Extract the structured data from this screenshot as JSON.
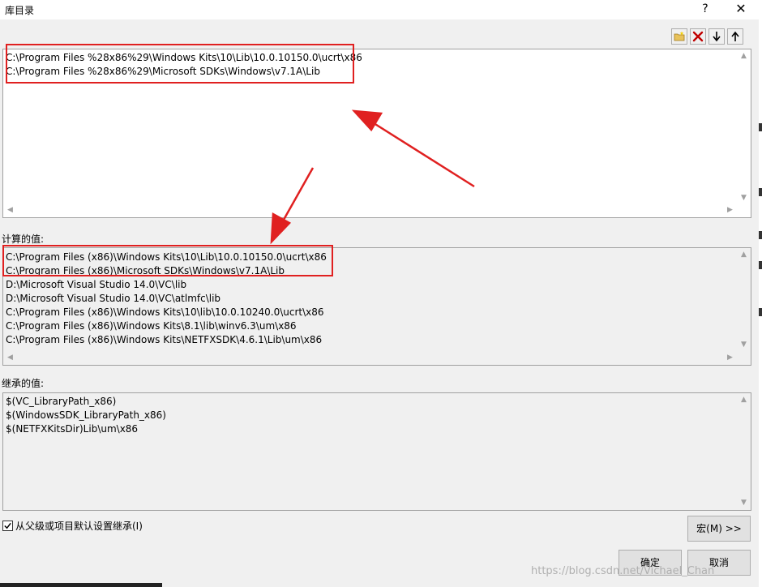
{
  "window": {
    "title": "库目录",
    "help_label": "?",
    "close_label": "✕"
  },
  "toolbar": {
    "new_icon": "new-folder-icon",
    "delete_icon": "delete-icon",
    "down_icon": "move-down-icon",
    "up_icon": "move-up-icon"
  },
  "edit_list": {
    "lines": [
      "C:\\Program Files %28x86%29\\Windows Kits\\10\\Lib\\10.0.10150.0\\ucrt\\x86",
      "C:\\Program Files %28x86%29\\Microsoft SDKs\\Windows\\v7.1A\\Lib"
    ]
  },
  "evaluated": {
    "label": "计算的值:",
    "lines": [
      "C:\\Program Files (x86)\\Windows Kits\\10\\Lib\\10.0.10150.0\\ucrt\\x86",
      "C:\\Program Files (x86)\\Microsoft SDKs\\Windows\\v7.1A\\Lib",
      "D:\\Microsoft Visual Studio 14.0\\VC\\lib",
      "D:\\Microsoft Visual Studio 14.0\\VC\\atlmfc\\lib",
      "C:\\Program Files (x86)\\Windows Kits\\10\\lib\\10.0.10240.0\\ucrt\\x86",
      "C:\\Program Files (x86)\\Windows Kits\\8.1\\lib\\winv6.3\\um\\x86",
      "C:\\Program Files (x86)\\Windows Kits\\NETFXSDK\\4.6.1\\Lib\\um\\x86"
    ]
  },
  "inherited": {
    "label": "继承的值:",
    "lines": [
      "$(VC_LibraryPath_x86)",
      "$(WindowsSDK_LibraryPath_x86)",
      "$(NETFXKitsDir)Lib\\um\\x86"
    ]
  },
  "inherit_checkbox": {
    "label": "从父级或项目默认设置继承(I)",
    "checked": true
  },
  "buttons": {
    "macros": "宏(M) >>",
    "ok": "确定",
    "cancel": "取消"
  },
  "watermark": "https://blog.csdn.net/Vichael_Chan",
  "colors": {
    "annotation_red": "#e02020"
  }
}
